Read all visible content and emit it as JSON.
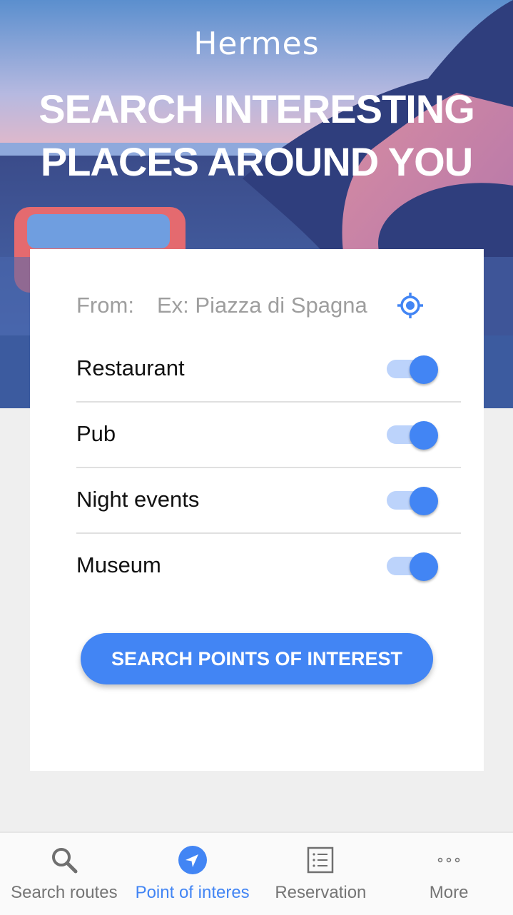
{
  "app": {
    "title": "Hermes",
    "headline": "SEARCH INTERESTING PLACES AROUND YOU"
  },
  "from": {
    "label": "From:",
    "placeholder": "Ex: Piazza di Spagna",
    "locate_icon": "my-location-icon"
  },
  "categories": [
    {
      "label": "Restaurant",
      "enabled": true
    },
    {
      "label": "Pub",
      "enabled": true
    },
    {
      "label": "Night events",
      "enabled": true
    },
    {
      "label": "Museum",
      "enabled": true
    }
  ],
  "search_button": "SEARCH POINTS OF INTEREST",
  "bottom_nav": [
    {
      "label": "Search routes",
      "icon": "search-icon",
      "active": false
    },
    {
      "label": "Point of interes",
      "icon": "navigation-arrow-icon",
      "active": true
    },
    {
      "label": "Reservation",
      "icon": "list-icon",
      "active": false
    },
    {
      "label": "More",
      "icon": "more-icon",
      "active": false
    }
  ],
  "colors": {
    "accent": "#4285f4",
    "toggle_track": "#bcd3fb",
    "background": "#efefef"
  }
}
